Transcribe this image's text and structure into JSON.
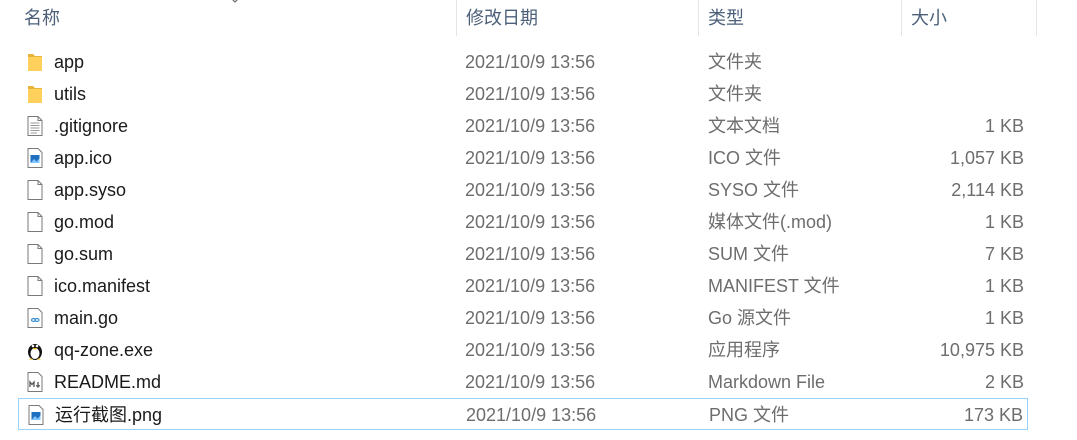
{
  "columns": {
    "name": "名称",
    "date": "修改日期",
    "type": "类型",
    "size": "大小"
  },
  "files": [
    {
      "name": "app",
      "date": "2021/10/9 13:56",
      "type": "文件夹",
      "size": "",
      "icon": "folder-icon"
    },
    {
      "name": "utils",
      "date": "2021/10/9 13:56",
      "type": "文件夹",
      "size": "",
      "icon": "folder-icon"
    },
    {
      "name": ".gitignore",
      "date": "2021/10/9 13:56",
      "type": "文本文档",
      "size": "1 KB",
      "icon": "text-file-icon"
    },
    {
      "name": "app.ico",
      "date": "2021/10/9 13:56",
      "type": "ICO 文件",
      "size": "1,057 KB",
      "icon": "image-file-icon"
    },
    {
      "name": "app.syso",
      "date": "2021/10/9 13:56",
      "type": "SYSO 文件",
      "size": "2,114 KB",
      "icon": "blank-file-icon"
    },
    {
      "name": "go.mod",
      "date": "2021/10/9 13:56",
      "type": "媒体文件(.mod)",
      "size": "1 KB",
      "icon": "blank-file-icon"
    },
    {
      "name": "go.sum",
      "date": "2021/10/9 13:56",
      "type": "SUM 文件",
      "size": "7 KB",
      "icon": "blank-file-icon"
    },
    {
      "name": "ico.manifest",
      "date": "2021/10/9 13:56",
      "type": "MANIFEST 文件",
      "size": "1 KB",
      "icon": "blank-file-icon"
    },
    {
      "name": "main.go",
      "date": "2021/10/9 13:56",
      "type": "Go 源文件",
      "size": "1 KB",
      "icon": "go-file-icon"
    },
    {
      "name": "qq-zone.exe",
      "date": "2021/10/9 13:56",
      "type": "应用程序",
      "size": "10,975 KB",
      "icon": "penguin-app-icon"
    },
    {
      "name": "README.md",
      "date": "2021/10/9 13:56",
      "type": "Markdown File",
      "size": "2 KB",
      "icon": "markdown-file-icon"
    },
    {
      "name": "运行截图.png",
      "date": "2021/10/9 13:56",
      "type": "PNG 文件",
      "size": "173 KB",
      "icon": "image-file-icon",
      "selected": true
    }
  ]
}
